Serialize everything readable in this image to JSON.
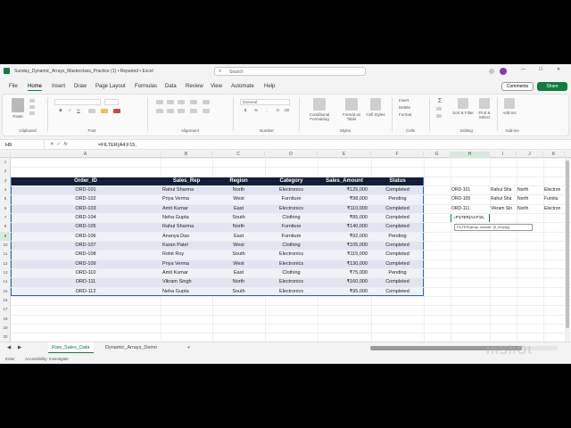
{
  "window": {
    "title": "Sunday_Dynamic_Arrays_Masterclass_Practice (1)  •  Repaired  •  Excel",
    "search_placeholder": "Search"
  },
  "menu_tabs": [
    "File",
    "Home",
    "Insert",
    "Draw",
    "Page Layout",
    "Formulas",
    "Data",
    "Review",
    "View",
    "Automate",
    "Help"
  ],
  "active_tab": "Home",
  "comments_label": "Comments",
  "share_label": "Share",
  "ribbon_groups": [
    "Clipboard",
    "Font",
    "Alignment",
    "Number",
    "Styles",
    "Cells",
    "Editing",
    "Add-ins"
  ],
  "ribbon_labels": {
    "paste": "Paste",
    "font_name": "",
    "number_format": "General",
    "conditional": "Conditional Formatting",
    "format_table": "Format as Table",
    "cell_styles": "Cell Styles",
    "insert": "Insert",
    "delete": "Delete",
    "format": "Format",
    "sort_filter": "Sort & Filter",
    "find_select": "Find & Select",
    "addins": "Add-ins"
  },
  "formula_bar": {
    "name_box": "H9",
    "formula": "=FILTER(A4:F15,"
  },
  "columns": [
    "A",
    "B",
    "C",
    "D",
    "E",
    "F",
    "G",
    "H",
    "I",
    "J",
    "K"
  ],
  "selected_column": "H",
  "rows": [
    "1",
    "2",
    "3",
    "4",
    "5",
    "6",
    "7",
    "8",
    "9",
    "10",
    "11",
    "12",
    "13",
    "14",
    "15",
    "16",
    "17",
    "18",
    "19",
    "20"
  ],
  "selected_row": "9",
  "table": {
    "headers": [
      "Order_ID",
      "Sales_Rep",
      "Region",
      "Category",
      "Sales_Amount",
      "Status"
    ],
    "rows": [
      [
        "ORD-101",
        "Rahul Sharma",
        "North",
        "Electronics",
        "₹125,000",
        "Completed"
      ],
      [
        "ORD-102",
        "Priya Verma",
        "West",
        "Furniture",
        "₹98,000",
        "Pending"
      ],
      [
        "ORD-103",
        "Amit Kumar",
        "East",
        "Electronics",
        "₹110,000",
        "Completed"
      ],
      [
        "ORD-104",
        "Neha Gupta",
        "South",
        "Clothing",
        "₹85,000",
        "Completed"
      ],
      [
        "ORD-105",
        "Rahul Sharma",
        "North",
        "Furniture",
        "₹140,000",
        "Completed"
      ],
      [
        "ORD-106",
        "Ananya Das",
        "East",
        "Furniture",
        "₹92,000",
        "Pending"
      ],
      [
        "ORD-107",
        "Karan Patel",
        "West",
        "Clothing",
        "₹105,000",
        "Completed"
      ],
      [
        "ORD-108",
        "Rohit Roy",
        "South",
        "Electronics",
        "₹115,000",
        "Completed"
      ],
      [
        "ORD-109",
        "Priya Verma",
        "West",
        "Electronics",
        "₹130,000",
        "Completed"
      ],
      [
        "ORD-110",
        "Amit Kumar",
        "East",
        "Clothing",
        "₹75,000",
        "Pending"
      ],
      [
        "ORD-111",
        "Vikram Singh",
        "North",
        "Electronics",
        "₹160,000",
        "Completed"
      ],
      [
        "ORD-112",
        "Neha Gupta",
        "South",
        "Electronics",
        "₹95,000",
        "Completed"
      ]
    ]
  },
  "filter_output": [
    [
      "ORD-101",
      "Rahul Sha",
      "North",
      "Electron"
    ],
    [
      "ORD-105",
      "Rahul Sha",
      "North",
      "Furnitu"
    ],
    [
      "ORD-111",
      "Vikram Sin",
      "North",
      "Electron"
    ]
  ],
  "active_cell_text": "=FILTER(A4:F15,",
  "formula_tooltip": "FILTER(array, include, [if_empty])",
  "sheet_tabs": [
    "Raw_Sales_Data",
    "Dynamic_Arrays_Demo"
  ],
  "active_sheet": "Raw_Sales_Data",
  "status": {
    "mode": "Enter",
    "accessibility": "Accessibility: Investigate"
  },
  "watermark": "InShOt",
  "colors": {
    "accent": "#107c41",
    "table_header": "#0f1e3a",
    "band_dark": "#dfe6f2",
    "band_light": "#eef2f9"
  }
}
